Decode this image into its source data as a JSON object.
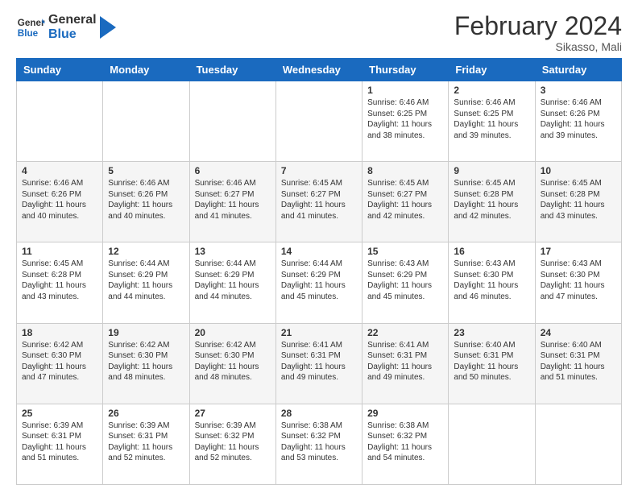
{
  "header": {
    "logo_line1": "General",
    "logo_line2": "Blue",
    "month_year": "February 2024",
    "location": "Sikasso, Mali"
  },
  "weekdays": [
    "Sunday",
    "Monday",
    "Tuesday",
    "Wednesday",
    "Thursday",
    "Friday",
    "Saturday"
  ],
  "weeks": [
    [
      {
        "day": "",
        "info": ""
      },
      {
        "day": "",
        "info": ""
      },
      {
        "day": "",
        "info": ""
      },
      {
        "day": "",
        "info": ""
      },
      {
        "day": "1",
        "info": "Sunrise: 6:46 AM\nSunset: 6:25 PM\nDaylight: 11 hours\nand 38 minutes."
      },
      {
        "day": "2",
        "info": "Sunrise: 6:46 AM\nSunset: 6:25 PM\nDaylight: 11 hours\nand 39 minutes."
      },
      {
        "day": "3",
        "info": "Sunrise: 6:46 AM\nSunset: 6:26 PM\nDaylight: 11 hours\nand 39 minutes."
      }
    ],
    [
      {
        "day": "4",
        "info": "Sunrise: 6:46 AM\nSunset: 6:26 PM\nDaylight: 11 hours\nand 40 minutes."
      },
      {
        "day": "5",
        "info": "Sunrise: 6:46 AM\nSunset: 6:26 PM\nDaylight: 11 hours\nand 40 minutes."
      },
      {
        "day": "6",
        "info": "Sunrise: 6:46 AM\nSunset: 6:27 PM\nDaylight: 11 hours\nand 41 minutes."
      },
      {
        "day": "7",
        "info": "Sunrise: 6:45 AM\nSunset: 6:27 PM\nDaylight: 11 hours\nand 41 minutes."
      },
      {
        "day": "8",
        "info": "Sunrise: 6:45 AM\nSunset: 6:27 PM\nDaylight: 11 hours\nand 42 minutes."
      },
      {
        "day": "9",
        "info": "Sunrise: 6:45 AM\nSunset: 6:28 PM\nDaylight: 11 hours\nand 42 minutes."
      },
      {
        "day": "10",
        "info": "Sunrise: 6:45 AM\nSunset: 6:28 PM\nDaylight: 11 hours\nand 43 minutes."
      }
    ],
    [
      {
        "day": "11",
        "info": "Sunrise: 6:45 AM\nSunset: 6:28 PM\nDaylight: 11 hours\nand 43 minutes."
      },
      {
        "day": "12",
        "info": "Sunrise: 6:44 AM\nSunset: 6:29 PM\nDaylight: 11 hours\nand 44 minutes."
      },
      {
        "day": "13",
        "info": "Sunrise: 6:44 AM\nSunset: 6:29 PM\nDaylight: 11 hours\nand 44 minutes."
      },
      {
        "day": "14",
        "info": "Sunrise: 6:44 AM\nSunset: 6:29 PM\nDaylight: 11 hours\nand 45 minutes."
      },
      {
        "day": "15",
        "info": "Sunrise: 6:43 AM\nSunset: 6:29 PM\nDaylight: 11 hours\nand 45 minutes."
      },
      {
        "day": "16",
        "info": "Sunrise: 6:43 AM\nSunset: 6:30 PM\nDaylight: 11 hours\nand 46 minutes."
      },
      {
        "day": "17",
        "info": "Sunrise: 6:43 AM\nSunset: 6:30 PM\nDaylight: 11 hours\nand 47 minutes."
      }
    ],
    [
      {
        "day": "18",
        "info": "Sunrise: 6:42 AM\nSunset: 6:30 PM\nDaylight: 11 hours\nand 47 minutes."
      },
      {
        "day": "19",
        "info": "Sunrise: 6:42 AM\nSunset: 6:30 PM\nDaylight: 11 hours\nand 48 minutes."
      },
      {
        "day": "20",
        "info": "Sunrise: 6:42 AM\nSunset: 6:30 PM\nDaylight: 11 hours\nand 48 minutes."
      },
      {
        "day": "21",
        "info": "Sunrise: 6:41 AM\nSunset: 6:31 PM\nDaylight: 11 hours\nand 49 minutes."
      },
      {
        "day": "22",
        "info": "Sunrise: 6:41 AM\nSunset: 6:31 PM\nDaylight: 11 hours\nand 49 minutes."
      },
      {
        "day": "23",
        "info": "Sunrise: 6:40 AM\nSunset: 6:31 PM\nDaylight: 11 hours\nand 50 minutes."
      },
      {
        "day": "24",
        "info": "Sunrise: 6:40 AM\nSunset: 6:31 PM\nDaylight: 11 hours\nand 51 minutes."
      }
    ],
    [
      {
        "day": "25",
        "info": "Sunrise: 6:39 AM\nSunset: 6:31 PM\nDaylight: 11 hours\nand 51 minutes."
      },
      {
        "day": "26",
        "info": "Sunrise: 6:39 AM\nSunset: 6:31 PM\nDaylight: 11 hours\nand 52 minutes."
      },
      {
        "day": "27",
        "info": "Sunrise: 6:39 AM\nSunset: 6:32 PM\nDaylight: 11 hours\nand 52 minutes."
      },
      {
        "day": "28",
        "info": "Sunrise: 6:38 AM\nSunset: 6:32 PM\nDaylight: 11 hours\nand 53 minutes."
      },
      {
        "day": "29",
        "info": "Sunrise: 6:38 AM\nSunset: 6:32 PM\nDaylight: 11 hours\nand 54 minutes."
      },
      {
        "day": "",
        "info": ""
      },
      {
        "day": "",
        "info": ""
      }
    ]
  ]
}
